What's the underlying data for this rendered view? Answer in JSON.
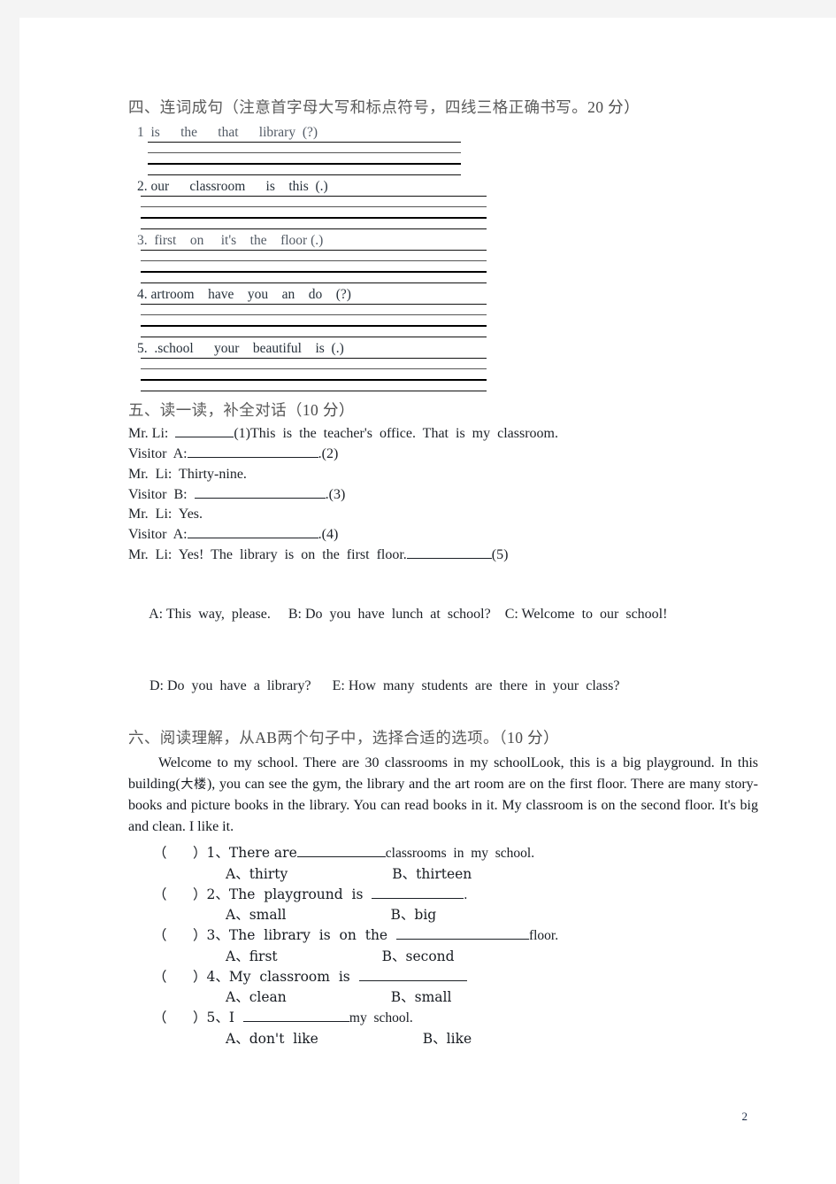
{
  "page": {
    "number": "2"
  },
  "section4": {
    "heading_cn": "四、连词成句（注意首字母大写和标点符号，四线三格正确书写。",
    "heading_points": "20 分）",
    "items": [
      {
        "label": "1",
        "words": "1  is      the      that      library  (?)",
        "line_start": 155,
        "line_end": 509
      },
      {
        "label": "2",
        "words": "2. our      classroom      is    this  (.)",
        "line_start": 147,
        "line_end": 538
      },
      {
        "label": "3",
        "words": "3.  first    on     it's    the    floor (.)",
        "line_start": 147,
        "line_end": 538
      },
      {
        "label": "4",
        "words": "4. artroom    have    you    an    do    (?)",
        "line_start": 147,
        "line_end": 538
      },
      {
        "label": "5",
        "words": "5.  .school      your    beautiful    is  (.)",
        "line_start": 147,
        "line_end": 538
      }
    ]
  },
  "section5": {
    "heading_cn": "五、读一读，补全对话（",
    "heading_points": "10 分）",
    "dialogue": [
      {
        "speaker": "Mr. Li:",
        "pre": "Mr. Li:  ",
        "blank_width": 66,
        "post": "(1)This  is  the  teacher's  office.  That  is  my  classroom."
      },
      {
        "speaker": "Visitor A:",
        "pre": "Visitor  A:",
        "blank_width": 148,
        "post": ".(2)"
      },
      {
        "speaker": "Mr. Li:",
        "pre": "Mr.  Li:  Thirty-nine.",
        "blank_width": 0,
        "post": ""
      },
      {
        "speaker": "Visitor B:",
        "pre": "Visitor  B:  ",
        "blank_width": 148,
        "post": ".(3)"
      },
      {
        "speaker": "Mr. Li:",
        "pre": "Mr.  Li:  Yes.",
        "blank_width": 0,
        "post": ""
      },
      {
        "speaker": "Visitor A:",
        "pre": "Visitor  A:",
        "blank_width": 148,
        "post": ".(4)"
      },
      {
        "speaker": "Mr. Li:",
        "pre": "Mr.  Li:  Yes!  The  library  is  on  the  first  floor.",
        "blank_width": 96,
        "post": "(5)"
      }
    ],
    "options_row1": "A: This  way,  please.     B: Do  you  have  lunch  at  school?    C: Welcome  to  our  school!",
    "options_row2": "D: Do  you  have  a  library?      E: How  many  students  are  there  in  your  class?"
  },
  "section6": {
    "heading_cn_a": "六、阅读理解，从",
    "heading_cn_lat": "AB",
    "heading_cn_b": "两个句子中，选择合适的选项。（",
    "heading_points": "10 分）",
    "passage_part1": "Welcome  to  my  school.  There  are  30  classrooms  in  my  school",
    "passage_part2": "Look,  this  is  a big playground. In this building(",
    "passage_cn": "大楼",
    "passage_part3": "),   you can see the gym, the library and the art room  are  on  the  first  floor.  There  are  many  story-books  and  picture  books  in  the library. You can read books in it. My classroom is on the second floor. It's big and clean. I like it.",
    "questions": [
      {
        "num": "1",
        "stem_pre": "（      ）1、There are",
        "blank_width": 100,
        "stem_post": "classrooms  in  my  school.",
        "option_a": "A、thirty",
        "option_b": "B、thirteen"
      },
      {
        "num": "2",
        "stem_pre": "（      ）2、The  playground  is  ",
        "blank_width": 104,
        "stem_post": ".",
        "option_a": "A、small",
        "option_b": "B、big"
      },
      {
        "num": "3",
        "stem_pre": "（      ）3、The  library  is  on  the  ",
        "blank_width": 150,
        "stem_post": "floor.",
        "option_a": "A、first",
        "option_b": "B、second"
      },
      {
        "num": "4",
        "stem_pre": "（      ）4、My  classroom  is  ",
        "blank_width": 122,
        "stem_post": "",
        "option_a": "A、clean",
        "option_b": "B、small"
      },
      {
        "num": "5",
        "stem_pre": "（      ）5、I  ",
        "blank_width": 120,
        "stem_post": "my  school.",
        "option_a": "A、don't  like",
        "option_b": "B、like"
      }
    ]
  }
}
